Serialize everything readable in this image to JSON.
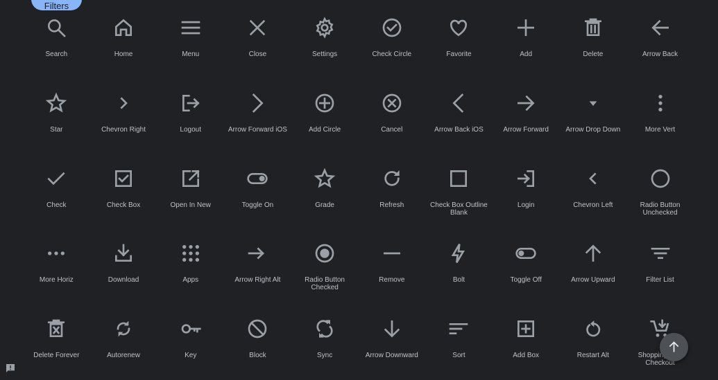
{
  "filter_button": {
    "label": "Filters"
  },
  "icons": [
    {
      "label": "Search",
      "icon": "search-icon"
    },
    {
      "label": "Home",
      "icon": "home-icon"
    },
    {
      "label": "Menu",
      "icon": "menu-icon"
    },
    {
      "label": "Close",
      "icon": "close-icon"
    },
    {
      "label": "Settings",
      "icon": "settings-icon"
    },
    {
      "label": "Check Circle",
      "icon": "check-circle-icon"
    },
    {
      "label": "Favorite",
      "icon": "favorite-icon"
    },
    {
      "label": "Add",
      "icon": "add-icon"
    },
    {
      "label": "Delete",
      "icon": "delete-icon"
    },
    {
      "label": "Arrow Back",
      "icon": "arrow-back-icon"
    },
    {
      "label": "Star",
      "icon": "star-icon"
    },
    {
      "label": "Chevron Right",
      "icon": "chevron-right-icon"
    },
    {
      "label": "Logout",
      "icon": "logout-icon"
    },
    {
      "label": "Arrow Forward iOS",
      "icon": "arrow-forward-ios-icon"
    },
    {
      "label": "Add Circle",
      "icon": "add-circle-icon"
    },
    {
      "label": "Cancel",
      "icon": "cancel-icon"
    },
    {
      "label": "Arrow Back iOS",
      "icon": "arrow-back-ios-icon"
    },
    {
      "label": "Arrow Forward",
      "icon": "arrow-forward-icon"
    },
    {
      "label": "Arrow Drop Down",
      "icon": "arrow-drop-down-icon"
    },
    {
      "label": "More Vert",
      "icon": "more-vert-icon"
    },
    {
      "label": "Check",
      "icon": "check-icon"
    },
    {
      "label": "Check Box",
      "icon": "check-box-icon"
    },
    {
      "label": "Open In New",
      "icon": "open-in-new-icon"
    },
    {
      "label": "Toggle On",
      "icon": "toggle-on-icon"
    },
    {
      "label": "Grade",
      "icon": "grade-icon"
    },
    {
      "label": "Refresh",
      "icon": "refresh-icon"
    },
    {
      "label": "Check Box Outline Blank",
      "icon": "check-box-outline-blank-icon"
    },
    {
      "label": "Login",
      "icon": "login-icon"
    },
    {
      "label": "Chevron Left",
      "icon": "chevron-left-icon"
    },
    {
      "label": "Radio Button Unchecked",
      "icon": "radio-button-unchecked-icon"
    },
    {
      "label": "More Horiz",
      "icon": "more-horiz-icon"
    },
    {
      "label": "Download",
      "icon": "download-icon"
    },
    {
      "label": "Apps",
      "icon": "apps-icon"
    },
    {
      "label": "Arrow Right Alt",
      "icon": "arrow-right-alt-icon"
    },
    {
      "label": "Radio Button Checked",
      "icon": "radio-button-checked-icon"
    },
    {
      "label": "Remove",
      "icon": "remove-icon"
    },
    {
      "label": "Bolt",
      "icon": "bolt-icon"
    },
    {
      "label": "Toggle Off",
      "icon": "toggle-off-icon"
    },
    {
      "label": "Arrow Upward",
      "icon": "arrow-upward-icon"
    },
    {
      "label": "Filter List",
      "icon": "filter-list-icon"
    },
    {
      "label": "Delete Forever",
      "icon": "delete-forever-icon"
    },
    {
      "label": "Autorenew",
      "icon": "autorenew-icon"
    },
    {
      "label": "Key",
      "icon": "key-icon"
    },
    {
      "label": "Block",
      "icon": "block-icon"
    },
    {
      "label": "Sync",
      "icon": "sync-icon"
    },
    {
      "label": "Arrow Downward",
      "icon": "arrow-downward-icon"
    },
    {
      "label": "Sort",
      "icon": "sort-icon"
    },
    {
      "label": "Add Box",
      "icon": "add-box-icon"
    },
    {
      "label": "Restart Alt",
      "icon": "restart-alt-icon"
    },
    {
      "label": "Shopping Cart Checkout",
      "icon": "shopping-cart-checkout-icon"
    }
  ],
  "scroll_top_button": {
    "icon": "arrow-upward-icon"
  },
  "feedback_button": {
    "icon": "feedback-icon"
  },
  "colors": {
    "background": "#202124",
    "icon": "#9aa0a6",
    "label": "#bdc1c6",
    "accent": "#8ab4f8",
    "fab": "#4d5055"
  }
}
